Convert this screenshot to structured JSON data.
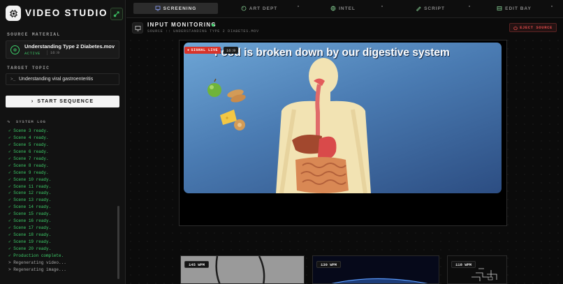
{
  "app": {
    "title": "VIDEO STUDIO"
  },
  "sidebar": {
    "source_label": "SOURCE MATERIAL",
    "source": {
      "name": "Understanding Type 2 Diabetes.mov",
      "status": "ACTIVE",
      "ratio": "16:9"
    },
    "topic_label": "TARGET TOPIC",
    "topic": {
      "value": "Understanding viral gastroenteritis"
    },
    "start_label": "START SEQUENCE",
    "log_label": "SYSTEM LOG",
    "log": [
      {
        "text": "✓ Scene 3 ready.",
        "type": "ok"
      },
      {
        "text": "✓ Scene 4 ready.",
        "type": "ok"
      },
      {
        "text": "✓ Scene 5 ready.",
        "type": "ok"
      },
      {
        "text": "✓ Scene 6 ready.",
        "type": "ok"
      },
      {
        "text": "✓ Scene 7 ready.",
        "type": "ok"
      },
      {
        "text": "✓ Scene 8 ready.",
        "type": "ok"
      },
      {
        "text": "✓ Scene 9 ready.",
        "type": "ok"
      },
      {
        "text": "✓ Scene 10 ready.",
        "type": "ok"
      },
      {
        "text": "✓ Scene 11 ready.",
        "type": "ok"
      },
      {
        "text": "✓ Scene 12 ready.",
        "type": "ok"
      },
      {
        "text": "✓ Scene 13 ready.",
        "type": "ok"
      },
      {
        "text": "✓ Scene 14 ready.",
        "type": "ok"
      },
      {
        "text": "✓ Scene 15 ready.",
        "type": "ok"
      },
      {
        "text": "✓ Scene 16 ready.",
        "type": "ok"
      },
      {
        "text": "✓ Scene 17 ready.",
        "type": "ok"
      },
      {
        "text": "✓ Scene 18 ready.",
        "type": "ok"
      },
      {
        "text": "✓ Scene 19 ready.",
        "type": "ok"
      },
      {
        "text": "✓ Scene 20 ready.",
        "type": "ok"
      },
      {
        "text": "✓ Production complete.",
        "type": "ok"
      },
      {
        "text": "> Regenerating video...",
        "type": "info"
      },
      {
        "text": "> Regenerating image...",
        "type": "info"
      }
    ]
  },
  "tabs": [
    {
      "label": "SCREENING",
      "icon": "monitor-icon",
      "active": true
    },
    {
      "label": "ART DEPT",
      "icon": "palette-icon",
      "active": false
    },
    {
      "label": "INTEL",
      "icon": "globe-icon",
      "active": false
    },
    {
      "label": "SCRIPT",
      "icon": "pen-icon",
      "active": false
    },
    {
      "label": "EDIT BAY",
      "icon": "film-icon",
      "active": false
    }
  ],
  "monitor": {
    "title": "INPUT MONITORING",
    "subtitle": "SOURCE :: UNDERSTANDING TYPE 2 DIABETES.MOV",
    "eject_label": "EJECT SOURCE"
  },
  "player": {
    "live_label": "SIGNAL LIVE",
    "ratio_label": "16:9",
    "caption": "Food is broken down by our digestive system"
  },
  "thumbnails": [
    {
      "wpm": "145 WPM"
    },
    {
      "wpm": "130 WPM"
    },
    {
      "wpm": "118 WPM"
    }
  ],
  "colors": {
    "accent_green": "#3ecf6a",
    "danger_red": "#e04a4a",
    "live_red": "#d8332a"
  }
}
